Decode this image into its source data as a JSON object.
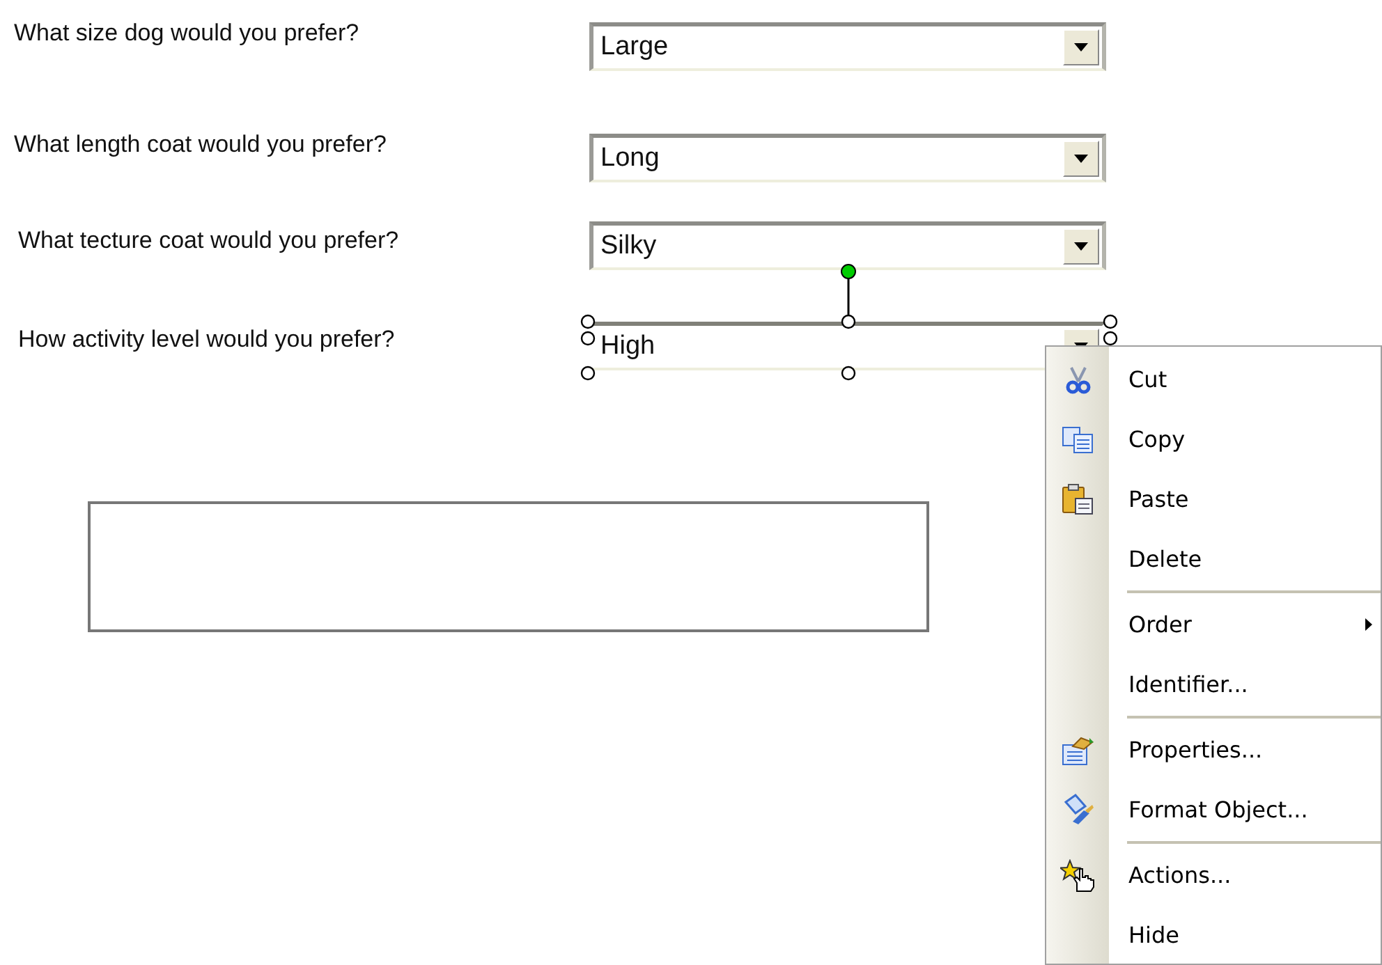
{
  "questions": [
    {
      "label": "What size dog would you prefer?",
      "value": "Large",
      "selected": false
    },
    {
      "label": "What length coat would you prefer?",
      "value": "Long",
      "selected": false
    },
    {
      "label": "What tecture coat would you prefer?",
      "value": "Silky",
      "selected": false
    },
    {
      "label": "How activity level would you prefer?",
      "value": "High",
      "selected": true
    }
  ],
  "context_menu": {
    "items": [
      {
        "label": "Cut",
        "separator_before": false,
        "submenu": false
      },
      {
        "label": "Copy",
        "separator_before": false,
        "submenu": false
      },
      {
        "label": "Paste",
        "separator_before": false,
        "submenu": false
      },
      {
        "label": "Delete",
        "separator_before": false,
        "submenu": false
      },
      {
        "label": "Order",
        "separator_before": true,
        "submenu": true
      },
      {
        "label": "Identifier...",
        "separator_before": false,
        "submenu": false
      },
      {
        "label": "Properties...",
        "separator_before": true,
        "submenu": false
      },
      {
        "label": "Format Object...",
        "separator_before": false,
        "submenu": false
      },
      {
        "label": "Actions...",
        "separator_before": true,
        "submenu": false
      },
      {
        "label": "Hide",
        "separator_before": false,
        "submenu": false
      }
    ]
  }
}
